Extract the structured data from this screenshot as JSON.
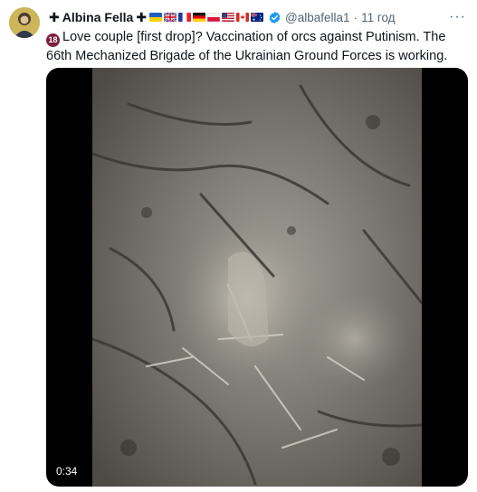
{
  "tweet": {
    "author_name": "Albina Fella",
    "cross_left": "✚",
    "cross_right": "✚",
    "handle": "@albafella1",
    "separator": "·",
    "timestamp": "11 год",
    "more_label": "···",
    "age_badge": "18",
    "text": "Love couple [first drop]? Vaccination of orcs against Putinism. The 66th Mechanized Brigade of the Ukrainian Ground Forces is working.",
    "flags": [
      "ukraine",
      "united-kingdom",
      "france",
      "germany",
      "poland",
      "usa",
      "canada",
      "australia"
    ]
  },
  "video": {
    "duration": "0:34"
  },
  "colors": {
    "verified": "#1d9bf0",
    "secondary_text": "#536471",
    "primary_text": "#0f1419",
    "badge": "#7a1f3d"
  },
  "icons": {
    "avatar": "avatar-icon",
    "verified": "verified-badge-icon",
    "more": "more-options-icon"
  }
}
